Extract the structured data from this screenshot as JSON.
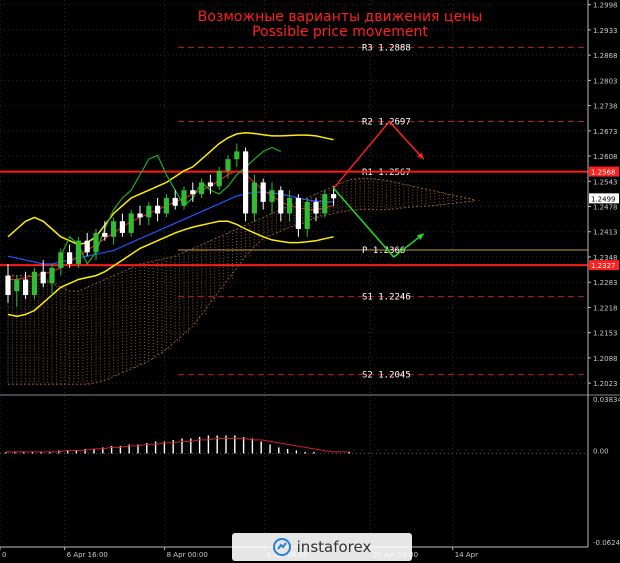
{
  "chart_data": {
    "type": "candlestick",
    "title": "Возможные варианты движения цены",
    "subtitle": "Possible price movement",
    "price_axis": {
      "ticks": [
        1.2998,
        1.2933,
        1.2868,
        1.2803,
        1.2738,
        1.2673,
        1.2608,
        1.2543,
        1.2478,
        1.2413,
        1.2348,
        1.2283,
        1.2218,
        1.2153,
        1.2088,
        1.2023
      ],
      "range": [
        1.1995,
        1.301
      ]
    },
    "price_badges": [
      {
        "value": "1.2568",
        "price": 1.2568,
        "color": "#ff2020"
      },
      {
        "value": "1.2499",
        "price": 1.2499,
        "color": "#ffffff"
      },
      {
        "value": "1.2327",
        "price": 1.2327,
        "color": "#ff2020"
      }
    ],
    "levels": [
      {
        "label": "R3  1.2888",
        "price": 1.2888,
        "style": "dashed",
        "color": "#b82020"
      },
      {
        "label": "R2  1.2697",
        "price": 1.2697,
        "style": "dashed",
        "color": "#b82020"
      },
      {
        "label": "R1  1.2567",
        "price": 1.2567,
        "style": "dashed",
        "color": "#b82020"
      },
      {
        "label": "P  1.2366",
        "price": 1.2366,
        "style": "solid",
        "color": "#c8a030"
      },
      {
        "label": "S1  1.2246",
        "price": 1.2246,
        "style": "dashed",
        "color": "#b82020"
      },
      {
        "label": "S2  1.2045",
        "price": 1.2045,
        "style": "dashed",
        "color": "#b82020"
      }
    ],
    "key_lines": [
      1.2568,
      1.2327
    ],
    "candles": [
      {
        "o": 1.23,
        "h": 1.233,
        "l": 1.223,
        "c": 1.225
      },
      {
        "o": 1.226,
        "h": 1.23,
        "l": 1.222,
        "c": 1.229
      },
      {
        "o": 1.229,
        "h": 1.231,
        "l": 1.224,
        "c": 1.225
      },
      {
        "o": 1.225,
        "h": 1.232,
        "l": 1.224,
        "c": 1.231
      },
      {
        "o": 1.231,
        "h": 1.234,
        "l": 1.227,
        "c": 1.228
      },
      {
        "o": 1.228,
        "h": 1.233,
        "l": 1.225,
        "c": 1.232
      },
      {
        "o": 1.232,
        "h": 1.237,
        "l": 1.23,
        "c": 1.236
      },
      {
        "o": 1.236,
        "h": 1.238,
        "l": 1.232,
        "c": 1.233
      },
      {
        "o": 1.233,
        "h": 1.24,
        "l": 1.232,
        "c": 1.239
      },
      {
        "o": 1.239,
        "h": 1.241,
        "l": 1.235,
        "c": 1.236
      },
      {
        "o": 1.236,
        "h": 1.242,
        "l": 1.234,
        "c": 1.241
      },
      {
        "o": 1.241,
        "h": 1.244,
        "l": 1.239,
        "c": 1.24
      },
      {
        "o": 1.24,
        "h": 1.245,
        "l": 1.238,
        "c": 1.244
      },
      {
        "o": 1.244,
        "h": 1.246,
        "l": 1.24,
        "c": 1.241
      },
      {
        "o": 1.241,
        "h": 1.247,
        "l": 1.24,
        "c": 1.246
      },
      {
        "o": 1.246,
        "h": 1.248,
        "l": 1.243,
        "c": 1.245
      },
      {
        "o": 1.245,
        "h": 1.249,
        "l": 1.243,
        "c": 1.248
      },
      {
        "o": 1.248,
        "h": 1.25,
        "l": 1.244,
        "c": 1.246
      },
      {
        "o": 1.246,
        "h": 1.251,
        "l": 1.245,
        "c": 1.25
      },
      {
        "o": 1.25,
        "h": 1.252,
        "l": 1.247,
        "c": 1.248
      },
      {
        "o": 1.248,
        "h": 1.253,
        "l": 1.247,
        "c": 1.252
      },
      {
        "o": 1.252,
        "h": 1.254,
        "l": 1.249,
        "c": 1.251
      },
      {
        "o": 1.251,
        "h": 1.255,
        "l": 1.25,
        "c": 1.254
      },
      {
        "o": 1.254,
        "h": 1.256,
        "l": 1.251,
        "c": 1.253
      },
      {
        "o": 1.253,
        "h": 1.258,
        "l": 1.252,
        "c": 1.257
      },
      {
        "o": 1.257,
        "h": 1.261,
        "l": 1.255,
        "c": 1.26
      },
      {
        "o": 1.26,
        "h": 1.264,
        "l": 1.258,
        "c": 1.262
      },
      {
        "o": 1.262,
        "h": 1.263,
        "l": 1.244,
        "c": 1.246
      },
      {
        "o": 1.246,
        "h": 1.256,
        "l": 1.244,
        "c": 1.254
      },
      {
        "o": 1.254,
        "h": 1.255,
        "l": 1.247,
        "c": 1.249
      },
      {
        "o": 1.249,
        "h": 1.254,
        "l": 1.246,
        "c": 1.252
      },
      {
        "o": 1.252,
        "h": 1.253,
        "l": 1.244,
        "c": 1.246
      },
      {
        "o": 1.246,
        "h": 1.252,
        "l": 1.244,
        "c": 1.25
      },
      {
        "o": 1.25,
        "h": 1.251,
        "l": 1.24,
        "c": 1.242
      },
      {
        "o": 1.242,
        "h": 1.25,
        "l": 1.24,
        "c": 1.249
      },
      {
        "o": 1.249,
        "h": 1.25,
        "l": 1.244,
        "c": 1.246
      },
      {
        "o": 1.246,
        "h": 1.252,
        "l": 1.245,
        "c": 1.251
      },
      {
        "o": 1.251,
        "h": 1.253,
        "l": 1.248,
        "c": 1.2499
      }
    ],
    "bollinger_upper": [
      1.24,
      1.242,
      1.244,
      1.245,
      1.244,
      1.242,
      1.24,
      1.239,
      1.238,
      1.2385,
      1.24,
      1.243,
      1.246,
      1.248,
      1.25,
      1.251,
      1.252,
      1.253,
      1.254,
      1.2555,
      1.257,
      1.258,
      1.26,
      1.262,
      1.264,
      1.2655,
      1.2665,
      1.2668,
      1.2666,
      1.2663,
      1.266,
      1.266,
      1.2661,
      1.2662,
      1.2662,
      1.266,
      1.2655,
      1.265
    ],
    "bollinger_lower": [
      1.22,
      1.2195,
      1.22,
      1.221,
      1.223,
      1.225,
      1.227,
      1.228,
      1.229,
      1.2295,
      1.23,
      1.231,
      1.2325,
      1.234,
      1.2355,
      1.237,
      1.238,
      1.239,
      1.24,
      1.241,
      1.2418,
      1.2425,
      1.243,
      1.2435,
      1.244,
      1.244,
      1.2432,
      1.242,
      1.241,
      1.24,
      1.2392,
      1.2388,
      1.2385,
      1.2385,
      1.2387,
      1.239,
      1.2395,
      1.24
    ],
    "ma_blue": [
      1.235,
      1.2345,
      1.234,
      1.2335,
      1.233,
      1.233,
      1.2335,
      1.234,
      1.2345,
      1.235,
      1.2355,
      1.236,
      1.2365,
      1.2375,
      1.2385,
      1.2395,
      1.2405,
      1.2415,
      1.2425,
      1.2435,
      1.2445,
      1.2455,
      1.2465,
      1.2475,
      1.2485,
      1.2495,
      1.2505,
      1.251,
      1.2515,
      1.2515,
      1.2513,
      1.251,
      1.2505,
      1.25,
      1.2495,
      1.2492,
      1.249,
      1.249
    ],
    "ma_red": [
      1.229,
      1.229,
      1.2295,
      1.23,
      1.2305,
      1.231,
      1.232,
      1.2335,
      1.235,
      1.2365,
      1.238,
      1.2395,
      1.241,
      1.2425,
      1.244,
      1.245,
      1.246,
      1.247,
      1.248,
      1.249,
      1.25,
      1.251,
      1.252,
      1.253,
      1.2545,
      1.256,
      1.257,
      1.256,
      1.254,
      1.252,
      1.2505,
      1.249,
      1.248,
      1.2475,
      1.247,
      1.247,
      1.2475,
      1.248
    ],
    "chikou_green": [
      1.235,
      1.24,
      1.238,
      1.233,
      1.236,
      1.242,
      1.247,
      1.25,
      1.252,
      1.256,
      1.26,
      1.261,
      1.256,
      1.252,
      1.248,
      1.25,
      1.254,
      1.252,
      1.251,
      1.253,
      1.256,
      1.258,
      1.26,
      1.262,
      1.263,
      1.262
    ],
    "cloud": {
      "span_a": [
        1.202,
        1.202,
        1.202,
        1.202,
        1.202,
        1.202,
        1.202,
        1.202,
        1.202,
        1.202,
        1.2025,
        1.203,
        1.204,
        1.205,
        1.206,
        1.207,
        1.208,
        1.2095,
        1.211,
        1.213,
        1.215,
        1.217,
        1.22,
        1.223,
        1.226,
        1.229,
        1.232,
        1.235,
        1.2375,
        1.2395,
        1.2405,
        1.2415,
        1.2425,
        1.243,
        1.244,
        1.245,
        1.2455,
        1.246,
        1.2465,
        1.2468,
        1.247,
        1.247,
        1.247,
        1.247,
        1.2472,
        1.2475,
        1.2477,
        1.2478,
        1.248,
        1.2482,
        1.2485,
        1.2487,
        1.249,
        1.2492
      ],
      "span_b": [
        1.23,
        1.23,
        1.23,
        1.23,
        1.229,
        1.228,
        1.227,
        1.226,
        1.226,
        1.227,
        1.228,
        1.229,
        1.23,
        1.231,
        1.232,
        1.233,
        1.2335,
        1.234,
        1.2345,
        1.235,
        1.236,
        1.237,
        1.238,
        1.239,
        1.24,
        1.241,
        1.242,
        1.243,
        1.244,
        1.245,
        1.246,
        1.247,
        1.248,
        1.249,
        1.25,
        1.251,
        1.252,
        1.253,
        1.254,
        1.2548,
        1.255,
        1.255,
        1.2548,
        1.2545,
        1.254,
        1.2535,
        1.253,
        1.2525,
        1.252,
        1.2515,
        1.251,
        1.2505,
        1.25,
        1.2495
      ]
    },
    "forecast_up": [
      [
        1.2525,
        0
      ],
      [
        1.2697,
        13
      ],
      [
        1.26,
        21
      ]
    ],
    "forecast_down": [
      [
        1.2525,
        0
      ],
      [
        1.2348,
        14
      ],
      [
        1.2408,
        21
      ]
    ],
    "x_axis": {
      "ticks": [
        {
          "label": "0",
          "pos": 0.0
        },
        {
          "label": "6 Apr 16:00",
          "pos": 0.11
        },
        {
          "label": "8 Apr 00:00",
          "pos": 0.28
        },
        {
          "label": "9 Apr 08:00",
          "pos": 0.45
        },
        {
          "label": "10 Apr 16:00",
          "pos": 0.63
        },
        {
          "label": "14 Apr",
          "pos": 0.77
        }
      ]
    },
    "oscillator": {
      "ticks": [
        {
          "label": "0.03834",
          "value": 0.03834
        },
        {
          "label": "0.00",
          "value": 0.0
        },
        {
          "label": "-0.06247",
          "value": -0.06247
        }
      ],
      "range": [
        -0.06247,
        0.03834
      ],
      "histogram": [
        0.001,
        0.001,
        0.001,
        0.001,
        0.001,
        0.001,
        0.002,
        0.002,
        0.002,
        0.003,
        0.003,
        0.004,
        0.005,
        0.005,
        0.006,
        0.006,
        0.007,
        0.008,
        0.008,
        0.009,
        0.01,
        0.01,
        0.011,
        0.012,
        0.012,
        0.012,
        0.012,
        0.011,
        0.01,
        0.008,
        0.006,
        0.004,
        0.003,
        0.002,
        0.001,
        0.001,
        0.0,
        0.0,
        0.0,
        0.001
      ],
      "signal": [
        0.001,
        0.001,
        0.001,
        0.001,
        0.001,
        0.001,
        0.001,
        0.002,
        0.002,
        0.002,
        0.003,
        0.003,
        0.004,
        0.004,
        0.005,
        0.005,
        0.006,
        0.006,
        0.007,
        0.007,
        0.008,
        0.008,
        0.009,
        0.009,
        0.01,
        0.01,
        0.01,
        0.01,
        0.009,
        0.009,
        0.008,
        0.007,
        0.006,
        0.005,
        0.004,
        0.003,
        0.002,
        0.001,
        0.001,
        0.001
      ]
    }
  },
  "watermark": {
    "text": "instaforex"
  },
  "colors": {
    "background": "#000000",
    "grid": "#2a2a2a",
    "axis_text": "#c8c8c8",
    "candle_bull": "#33bb33",
    "candle_bear": "#ffffff",
    "bollinger": "#ffee00",
    "ma_blue": "#2255ff",
    "ma_red": "#cc2222",
    "chikou": "#22aa22",
    "cloud": "#8a5a30",
    "forecast_up": "#ff2020",
    "forecast_down": "#22dd22",
    "title": "#ff2020"
  }
}
